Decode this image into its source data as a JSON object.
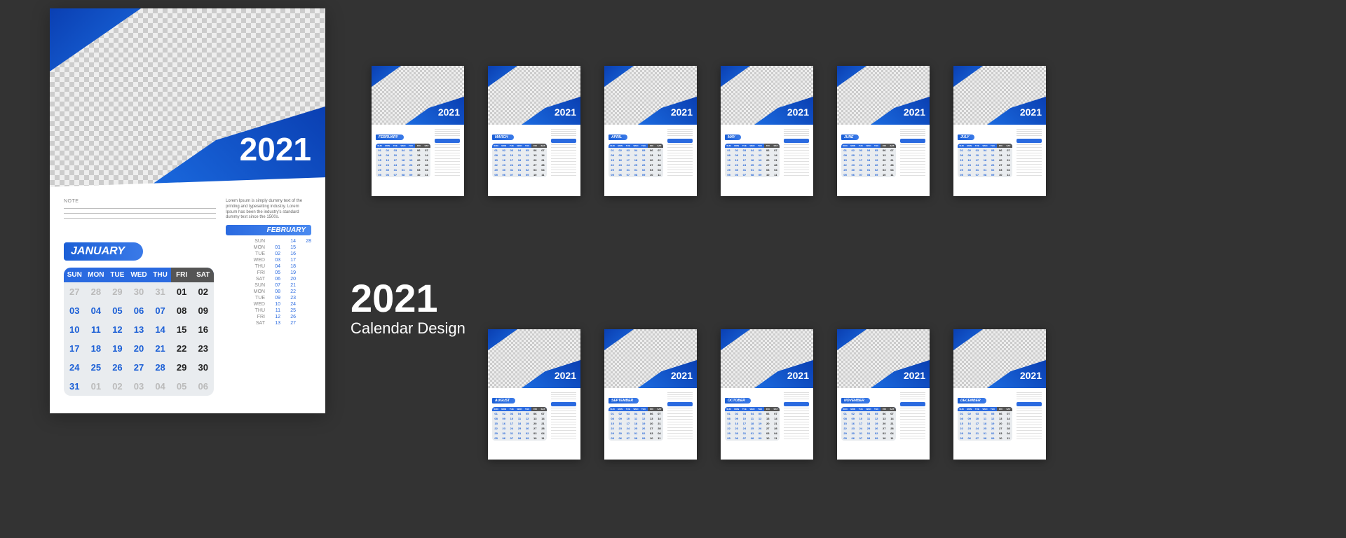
{
  "year": "2021",
  "title_year": "2021",
  "title_sub": "Calendar Design",
  "note_label": "NOTE",
  "lipsum": "Lorem Ipsum is simply dummy text of the printing and typesetting industry. Lorem Ipsum has been the industry's standard dummy text since the 1500s.",
  "main_month": "JANUARY",
  "next_month": "FEBRUARY",
  "day_headers": [
    "SUN",
    "MON",
    "TUE",
    "WED",
    "THU",
    "FRI",
    "SAT"
  ],
  "january_grid": [
    [
      "27",
      "28",
      "29",
      "30",
      "31",
      "01",
      "02"
    ],
    [
      "03",
      "04",
      "05",
      "06",
      "07",
      "08",
      "09"
    ],
    [
      "10",
      "11",
      "12",
      "13",
      "14",
      "15",
      "16"
    ],
    [
      "17",
      "18",
      "19",
      "20",
      "21",
      "22",
      "23"
    ],
    [
      "24",
      "25",
      "26",
      "27",
      "28",
      "29",
      "30"
    ],
    [
      "31",
      "01",
      "02",
      "03",
      "04",
      "05",
      "06"
    ]
  ],
  "january_out_start": 5,
  "january_out_end": 6,
  "feb_mini": [
    {
      "d": "SUN",
      "v": [
        "",
        "14",
        "28"
      ]
    },
    {
      "d": "MON",
      "v": [
        "01",
        "15",
        ""
      ]
    },
    {
      "d": "TUE",
      "v": [
        "02",
        "16",
        ""
      ]
    },
    {
      "d": "WED",
      "v": [
        "03",
        "17",
        ""
      ]
    },
    {
      "d": "THU",
      "v": [
        "04",
        "18",
        ""
      ]
    },
    {
      "d": "FRI",
      "v": [
        "05",
        "19",
        ""
      ]
    },
    {
      "d": "SAT",
      "v": [
        "06",
        "20",
        ""
      ]
    },
    {
      "d": "SUN",
      "v": [
        "07",
        "21",
        ""
      ]
    },
    {
      "d": "MON",
      "v": [
        "08",
        "22",
        ""
      ]
    },
    {
      "d": "TUE",
      "v": [
        "09",
        "23",
        ""
      ]
    },
    {
      "d": "WED",
      "v": [
        "10",
        "24",
        ""
      ]
    },
    {
      "d": "THU",
      "v": [
        "11",
        "25",
        ""
      ]
    },
    {
      "d": "FRI",
      "v": [
        "12",
        "26",
        ""
      ]
    },
    {
      "d": "SAT",
      "v": [
        "13",
        "27",
        ""
      ]
    }
  ],
  "thumb_months_row1": [
    "FEBRUARY",
    "MARCH",
    "APRIL",
    "MAY",
    "JUNE",
    "JULY"
  ],
  "thumb_months_row2": [
    "AUGUST",
    "SEPTEMBER",
    "OCTOBER",
    "NOVEMBER",
    "DECEMBER"
  ]
}
